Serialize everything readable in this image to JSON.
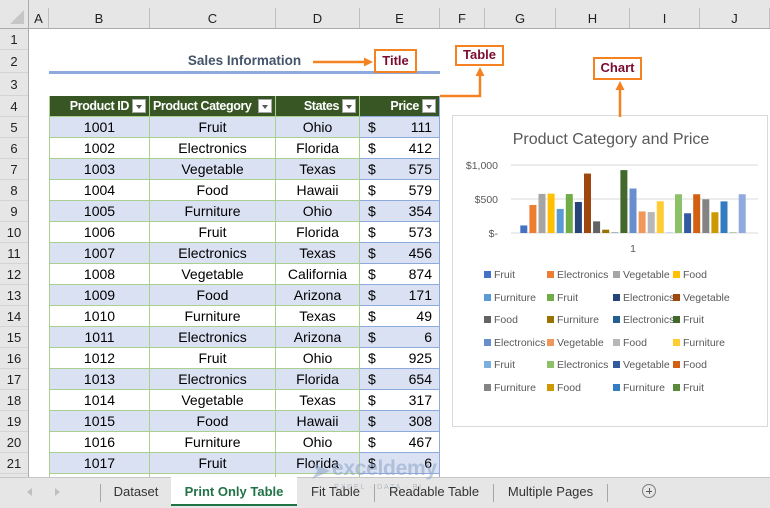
{
  "grid": {
    "columns": [
      "A",
      "B",
      "C",
      "D",
      "E",
      "F",
      "G",
      "H",
      "I",
      "J"
    ],
    "rows": [
      "1",
      "2",
      "3",
      "4",
      "5",
      "6",
      "7",
      "8",
      "9",
      "10",
      "11",
      "12",
      "13",
      "14",
      "15",
      "16",
      "17",
      "18",
      "19",
      "20",
      "21"
    ]
  },
  "sheet": {
    "title": "Sales Information",
    "table": {
      "headers": [
        "Product ID",
        "Product Category",
        "States",
        "Price"
      ],
      "currency_symbol": "$",
      "header_color": "#375623",
      "band_color": "#D9E1F2",
      "rows": [
        {
          "id": "1001",
          "category": "Fruit",
          "state": "Ohio",
          "price": "111"
        },
        {
          "id": "1002",
          "category": "Electronics",
          "state": "Florida",
          "price": "412"
        },
        {
          "id": "1003",
          "category": "Vegetable",
          "state": "Texas",
          "price": "575"
        },
        {
          "id": "1004",
          "category": "Food",
          "state": "Hawaii",
          "price": "579"
        },
        {
          "id": "1005",
          "category": "Furniture",
          "state": "Ohio",
          "price": "354"
        },
        {
          "id": "1006",
          "category": "Fruit",
          "state": "Florida",
          "price": "573"
        },
        {
          "id": "1007",
          "category": "Electronics",
          "state": "Texas",
          "price": "456"
        },
        {
          "id": "1008",
          "category": "Vegetable",
          "state": "California",
          "price": "874"
        },
        {
          "id": "1009",
          "category": "Food",
          "state": "Arizona",
          "price": "171"
        },
        {
          "id": "1010",
          "category": "Furniture",
          "state": "Texas",
          "price": "49"
        },
        {
          "id": "1011",
          "category": "Electronics",
          "state": "Arizona",
          "price": "6"
        },
        {
          "id": "1012",
          "category": "Fruit",
          "state": "Ohio",
          "price": "925"
        },
        {
          "id": "1013",
          "category": "Electronics",
          "state": "Florida",
          "price": "654"
        },
        {
          "id": "1014",
          "category": "Vegetable",
          "state": "Texas",
          "price": "317"
        },
        {
          "id": "1015",
          "category": "Food",
          "state": "Hawaii",
          "price": "308"
        },
        {
          "id": "1016",
          "category": "Furniture",
          "state": "Ohio",
          "price": "467"
        },
        {
          "id": "1017",
          "category": "Fruit",
          "state": "Florida",
          "price": "6"
        }
      ]
    }
  },
  "annotations": {
    "title_label": "Title",
    "table_label": "Table",
    "chart_label": "Chart",
    "accent_color": "#F58220",
    "text_color": "#7B0C2E"
  },
  "chart_data": {
    "type": "bar",
    "title": "Product Category and Price",
    "xlabel": "",
    "ylabel": "",
    "categories": [
      "1"
    ],
    "ylim": [
      0,
      1000
    ],
    "yticks": [
      {
        "value": 0,
        "label": "$-"
      },
      {
        "value": 500,
        "label": "$500"
      },
      {
        "value": 1000,
        "label": "$1,000"
      }
    ],
    "grid": true,
    "legend": "bottom",
    "series": [
      {
        "name": "Fruit",
        "values": [
          111
        ],
        "color": "#4472C4"
      },
      {
        "name": "Electronics",
        "values": [
          412
        ],
        "color": "#ED7D31"
      },
      {
        "name": "Vegetable",
        "values": [
          575
        ],
        "color": "#A5A5A5"
      },
      {
        "name": "Food",
        "values": [
          579
        ],
        "color": "#FFC000"
      },
      {
        "name": "Furniture",
        "values": [
          354
        ],
        "color": "#5B9BD5"
      },
      {
        "name": "Fruit",
        "values": [
          573
        ],
        "color": "#70AD47"
      },
      {
        "name": "Electronics",
        "values": [
          456
        ],
        "color": "#264478"
      },
      {
        "name": "Vegetable",
        "values": [
          874
        ],
        "color": "#9E480E"
      },
      {
        "name": "Food",
        "values": [
          171
        ],
        "color": "#636363"
      },
      {
        "name": "Furniture",
        "values": [
          49
        ],
        "color": "#997300"
      },
      {
        "name": "Electronics",
        "values": [
          6
        ],
        "color": "#255E91"
      },
      {
        "name": "Fruit",
        "values": [
          925
        ],
        "color": "#43682B"
      },
      {
        "name": "Electronics",
        "values": [
          654
        ],
        "color": "#698ED0"
      },
      {
        "name": "Vegetable",
        "values": [
          317
        ],
        "color": "#F1975A"
      },
      {
        "name": "Food",
        "values": [
          308
        ],
        "color": "#B7B7B7"
      },
      {
        "name": "Furniture",
        "values": [
          467
        ],
        "color": "#FFCD33"
      },
      {
        "name": "Fruit",
        "values": [
          6
        ],
        "color": "#7CAFDD"
      },
      {
        "name": "Electronics",
        "values": [
          570
        ],
        "color": "#8CC168"
      },
      {
        "name": "Vegetable",
        "values": [
          290
        ],
        "color": "#335AA1"
      },
      {
        "name": "Food",
        "values": [
          570
        ],
        "color": "#D26012"
      },
      {
        "name": "Furniture",
        "values": [
          495
        ],
        "color": "#848484"
      },
      {
        "name": "Food",
        "values": [
          305
        ],
        "color": "#CC9A00"
      },
      {
        "name": "Furniture",
        "values": [
          465
        ],
        "color": "#327DC2"
      },
      {
        "name": "Fruit",
        "values": [
          6
        ],
        "color": "#5A8A39"
      },
      {
        "name": null,
        "values": [
          570
        ],
        "color": "#8FAADC"
      }
    ]
  },
  "tabs": [
    {
      "label": "Dataset",
      "active": false
    },
    {
      "label": "Print Only Table",
      "active": true
    },
    {
      "label": "Fit Table",
      "active": false
    },
    {
      "label": "Readable Table",
      "active": false
    },
    {
      "label": "Multiple Pages",
      "active": false
    }
  ],
  "watermark": {
    "name": "exceldemy",
    "tagline": "EXCEL · DATA · BI"
  }
}
